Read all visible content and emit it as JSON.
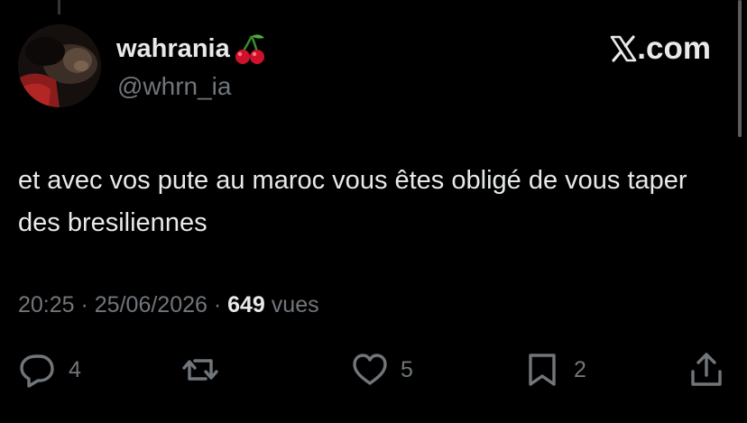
{
  "author": {
    "display_name": "wahrania",
    "display_emoji": "cherry-emoji",
    "handle": "@whrn_ia"
  },
  "brand": {
    "label": ".com",
    "logo_icon": "x-logo-icon"
  },
  "tweet": {
    "text": "et avec vos pute au maroc vous êtes obligé de vous taper des bresiliennes",
    "time": "20:25",
    "separator": " · ",
    "date": "25/06/2026",
    "views_count": "649",
    "views_label": " vues"
  },
  "actions": {
    "replies": "4",
    "reposts": "",
    "likes": "5",
    "bookmarks": "2"
  },
  "colors": {
    "background": "#000000",
    "primary_text": "#e7e9ea",
    "secondary_text": "#71767b"
  }
}
